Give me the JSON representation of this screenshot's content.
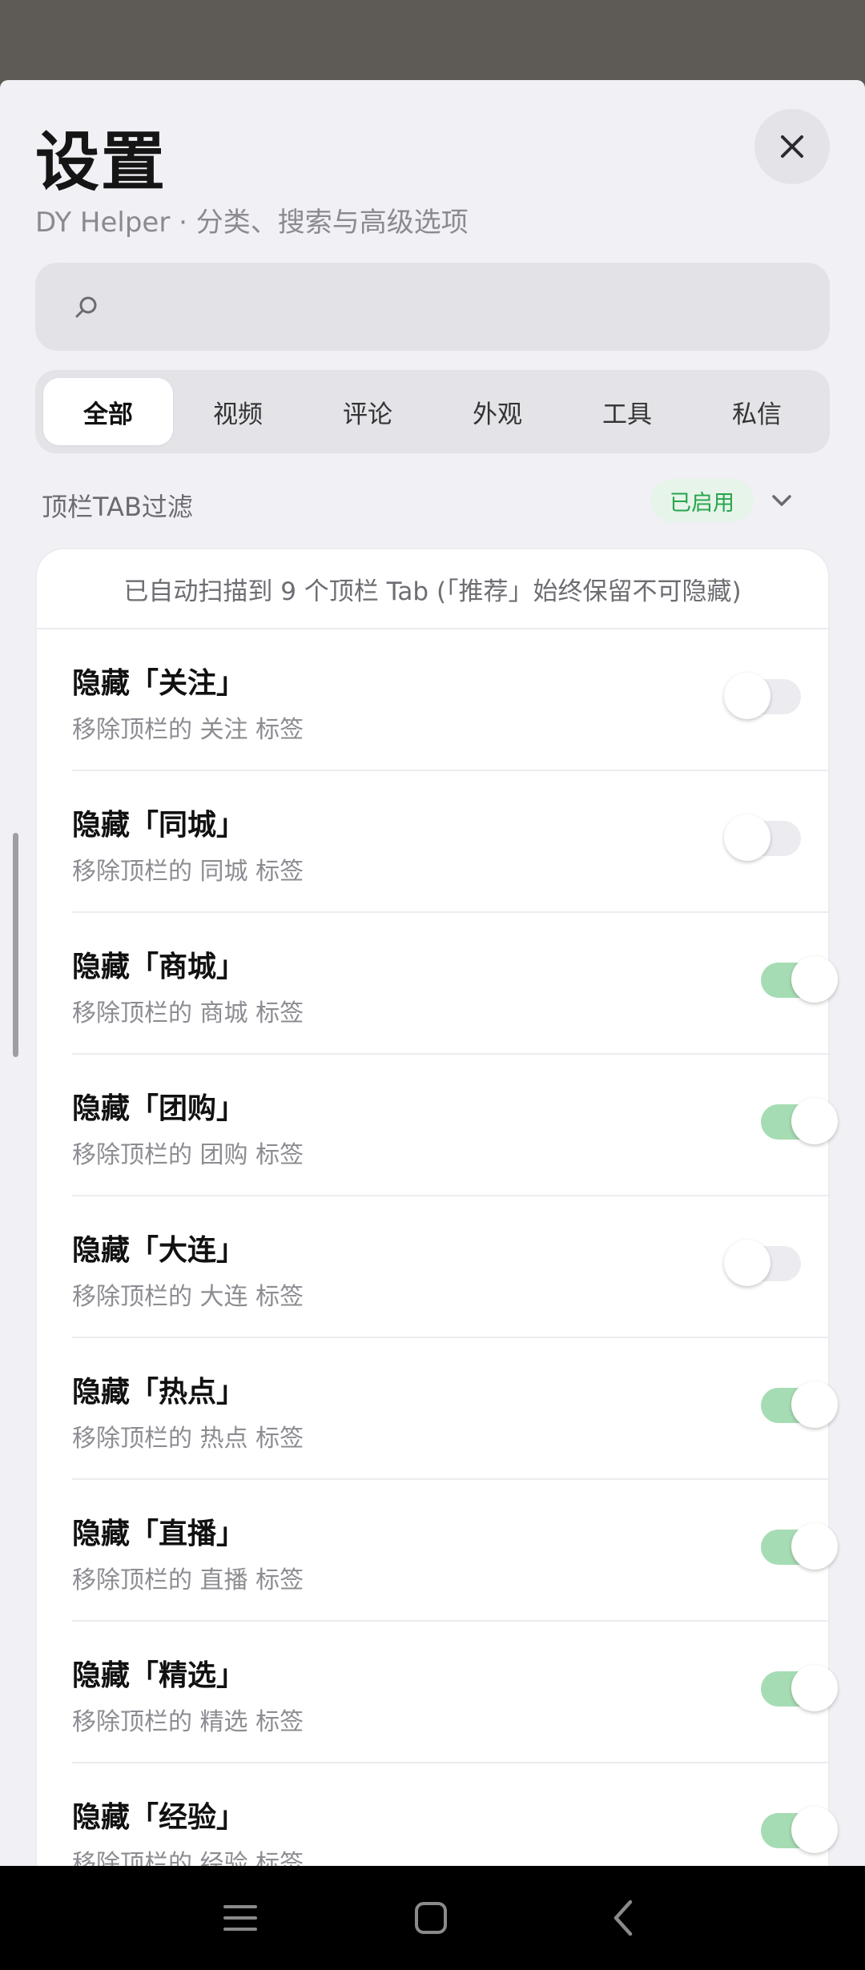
{
  "header": {
    "title": "设置",
    "subtitle": "DY Helper · 分类、搜索与高级选项"
  },
  "search": {
    "placeholder": "",
    "value": ""
  },
  "tabs": [
    {
      "label": "全部",
      "active": true
    },
    {
      "label": "视频",
      "active": false
    },
    {
      "label": "评论",
      "active": false
    },
    {
      "label": "外观",
      "active": false
    },
    {
      "label": "工具",
      "active": false
    },
    {
      "label": "私信",
      "active": false
    }
  ],
  "section": {
    "title": "顶栏TAB过滤",
    "status": "已启用",
    "note": "已自动扫描到 9 个顶栏 Tab (「推荐」始终保留不可隐藏)"
  },
  "items": [
    {
      "title": "隐藏「关注」",
      "desc": "移除顶栏的 关注 标签",
      "on": false
    },
    {
      "title": "隐藏「同城」",
      "desc": "移除顶栏的 同城 标签",
      "on": false
    },
    {
      "title": "隐藏「商城」",
      "desc": "移除顶栏的 商城 标签",
      "on": true
    },
    {
      "title": "隐藏「团购」",
      "desc": "移除顶栏的 团购 标签",
      "on": true
    },
    {
      "title": "隐藏「大连」",
      "desc": "移除顶栏的 大连 标签",
      "on": false
    },
    {
      "title": "隐藏「热点」",
      "desc": "移除顶栏的 热点 标签",
      "on": true
    },
    {
      "title": "隐藏「直播」",
      "desc": "移除顶栏的 直播 标签",
      "on": true
    },
    {
      "title": "隐藏「精选」",
      "desc": "移除顶栏的 精选 标签",
      "on": true
    },
    {
      "title": "隐藏「经验」",
      "desc": "移除顶栏的 经验 标签",
      "on": true
    }
  ],
  "icons": {
    "close": "close-icon",
    "search": "search-icon",
    "chevron": "chevron-down-icon",
    "nav_menu": "menu-icon",
    "nav_home": "home-icon",
    "nav_back": "back-icon"
  },
  "colors": {
    "accent_green": "#27a54a",
    "toggle_on": "#a6dcb3",
    "sheet_bg": "#f0f0f5"
  }
}
